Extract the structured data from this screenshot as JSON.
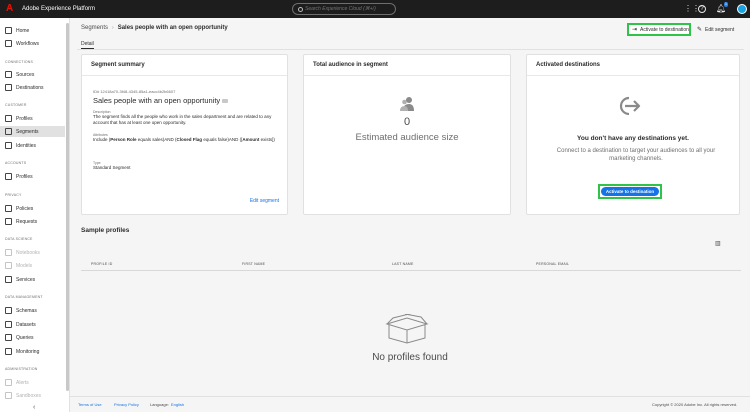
{
  "app": {
    "title": "Adobe Experience Platform",
    "search_placeholder": "Search Experience Cloud (⌘+/)",
    "notif_count": "1"
  },
  "sidebar": {
    "home": "Home",
    "workflows": "Workflows",
    "h_connections": "CONNECTIONS",
    "sources": "Sources",
    "destinations": "Destinations",
    "h_customer": "CUSTOMER",
    "profiles": "Profiles",
    "segments": "Segments",
    "identities": "Identities",
    "h_accounts": "ACCOUNTS",
    "acc_profiles": "Profiles",
    "h_privacy": "PRIVACY",
    "policies": "Policies",
    "requests": "Requests",
    "h_data_science": "DATA SCIENCE",
    "notebooks": "Notebooks",
    "models": "Models",
    "services": "Services",
    "h_data_mgmt": "DATA MANAGEMENT",
    "schemas": "Schemas",
    "datasets": "Datasets",
    "queries": "Queries",
    "monitoring": "Monitoring",
    "h_admin": "ADMINISTRATION",
    "alerts": "Alerts",
    "sandboxes": "Sandboxes",
    "collapse": "‹"
  },
  "header": {
    "breadcrumb_parent": "Segments",
    "breadcrumb_sep": "›",
    "title": "Sales people with an open opportunity",
    "activate_label": "Activate to destination",
    "edit_label": "Edit segment",
    "tab_detail": "Detail"
  },
  "summary": {
    "card_title": "Segment summary",
    "id": "ID# 12418a70-3f48-4345-85a1-eacc4b2b6607",
    "name": "Sales people with an open opportunity",
    "desc_label": "Description",
    "desc": "The segment finds all the people who work in the sales department and are related to any account that has at least one open opportunity.",
    "attr_label": "Attributes",
    "attr_pre": "Include (",
    "attr_b1": "Person Role",
    "attr_mid1": " equals sales)AND (",
    "attr_b2": "Closed Flag",
    "attr_mid2": " equals false)AND ([",
    "attr_b3": "Amount",
    "attr_post": " exists])",
    "type_label": "Type",
    "type": "Standard Segment",
    "edit_link": "Edit segment"
  },
  "audience": {
    "card_title": "Total audience in segment",
    "count": "0",
    "label": "Estimated audience size"
  },
  "activated": {
    "card_title": "Activated destinations",
    "empty_heading": "You don't have any destinations yet.",
    "empty_sub": "Connect to a destination to target your audiences to all your marketing channels.",
    "button": "Activate to destination"
  },
  "sample_profiles": {
    "title": "Sample profiles",
    "columns": [
      "PROFILE ID",
      "FIRST NAME",
      "LAST NAME",
      "PERSONAL EMAIL"
    ],
    "empty": "No profiles found"
  },
  "footer": {
    "terms": "Terms of Use",
    "privacy": "Privacy Policy",
    "language_label": "Language:",
    "language": "English",
    "copyright": "Copyright © 2020 Adobe Inc. All rights reserved."
  },
  "colors": {
    "accent": "#1473e6",
    "highlight": "#2fc449",
    "topbar": "#1d1d1d",
    "brand": "#eb1000"
  }
}
